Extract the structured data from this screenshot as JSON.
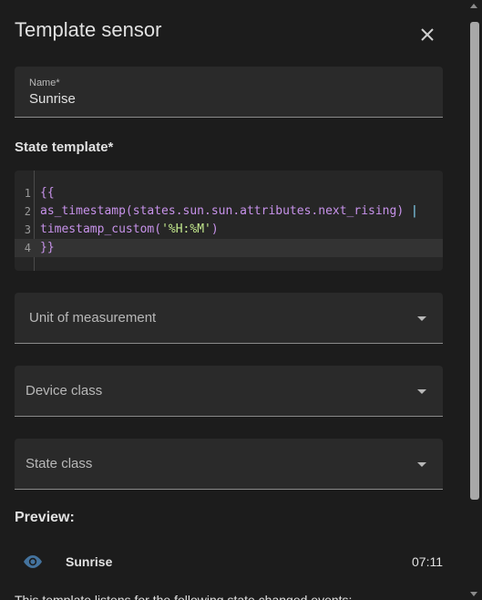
{
  "dialog": {
    "title": "Template sensor"
  },
  "name_field": {
    "label": "Name*",
    "value": "Sunrise"
  },
  "state_template": {
    "label": "State template*",
    "line_numbers": [
      "1",
      "2",
      "3",
      "4"
    ],
    "lines": {
      "l1_open": "{{",
      "l2_code": "as_timestamp(states.sun.sun.attributes.next_rising) ",
      "l2_pipe": "|",
      "l3_fn": "timestamp_custom(",
      "l3_str": "'%H:%M'",
      "l3_close": ")",
      "l4_close": "}}"
    }
  },
  "selects": {
    "unit": "Unit of measurement",
    "device_class": "Device class",
    "state_class": "State class"
  },
  "preview": {
    "label": "Preview:",
    "entity_name": "Sunrise",
    "entity_value": "07:11",
    "icon": "eye-icon"
  },
  "footer": {
    "text": "This template listens for the following state changed events:"
  },
  "colors": {
    "background": "#1c1c1c",
    "field": "#2a2a2a",
    "accent_icon": "#44739e"
  }
}
